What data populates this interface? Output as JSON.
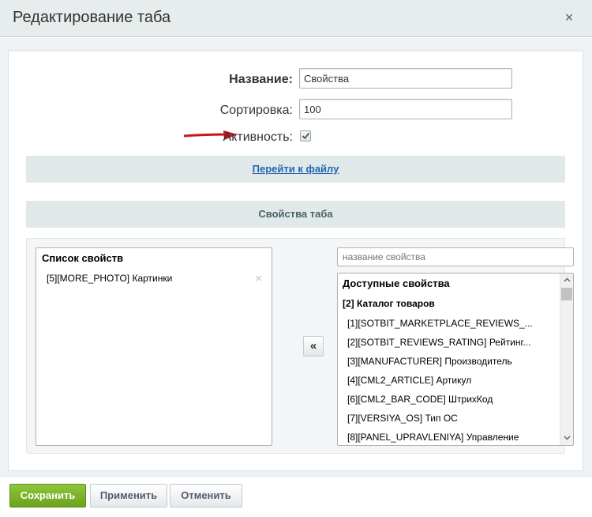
{
  "dialog": {
    "title": "Редактирование таба",
    "close_symbol": "×"
  },
  "form": {
    "name_label": "Название:",
    "name_value": "Свойства",
    "sort_label": "Сортировка:",
    "sort_value": "100",
    "active_label": "Активность:",
    "active_checked": true
  },
  "links": {
    "goto_file": "Перейти к файлу"
  },
  "section": {
    "title": "Свойства таба"
  },
  "selected_list": {
    "title": "Список свойств",
    "items": [
      "[5][MORE_PHOTO] Картинки"
    ],
    "remove_symbol": "×"
  },
  "move_button": {
    "symbol": "«"
  },
  "search": {
    "placeholder": "название свойства"
  },
  "available": {
    "title": "Доступные свойства",
    "group": "[2] Каталог товаров",
    "items": [
      "[1][SOTBIT_MARKETPLACE_REVIEWS_...",
      "[2][SOTBIT_REVIEWS_RATING] Рейтинг...",
      "[3][MANUFACTURER] Производитель",
      "[4][CML2_ARTICLE] Артикул",
      "[6][CML2_BAR_CODE] ШтрихКод",
      "[7][VERSIYA_OS] Тип ОС",
      "[8][PANEL_UPRAVLENIYA] Управление"
    ]
  },
  "footer": {
    "save": "Сохранить",
    "apply": "Применить",
    "cancel": "Отменить"
  },
  "colors": {
    "save_button": "#7bb32e",
    "link": "#2067b0",
    "arrow": "#c8161d"
  },
  "icons": {
    "close": "close-icon",
    "checkbox": "checkmark-icon",
    "move_left": "double-chevron-left-icon",
    "scroll_up": "chevron-up-icon",
    "scroll_down": "chevron-down-icon"
  }
}
